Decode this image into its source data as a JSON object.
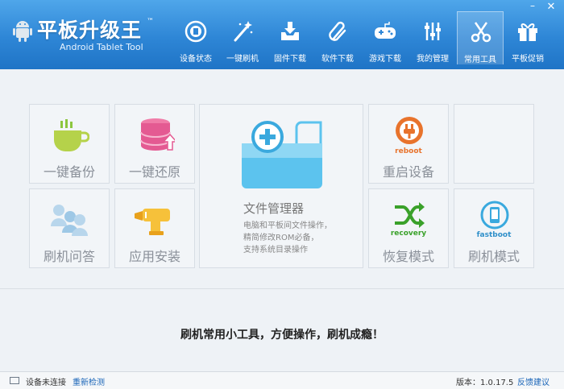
{
  "app": {
    "title": "平板升级王",
    "tm": "™",
    "subtitle": "Android Tablet Tool"
  },
  "window": {
    "minimize": "–",
    "close": "✕"
  },
  "nav": [
    {
      "label": "设备状态",
      "icon": "device-status-icon"
    },
    {
      "label": "一键刷机",
      "icon": "magic-wand-icon"
    },
    {
      "label": "固件下载",
      "icon": "firmware-download-icon"
    },
    {
      "label": "软件下载",
      "icon": "paperclip-icon"
    },
    {
      "label": "游戏下载",
      "icon": "gamepad-icon"
    },
    {
      "label": "我的管理",
      "icon": "sliders-icon"
    },
    {
      "label": "常用工具",
      "icon": "scissors-icon",
      "active": true
    },
    {
      "label": "平板促销",
      "icon": "gift-icon"
    }
  ],
  "tiles": {
    "backup": "一键备份",
    "restore": "一键还原",
    "file_manager": {
      "title": "文件管理器",
      "desc": [
        "电脑和平板间文件操作，",
        "精简修改ROM必备，",
        "支持系统目录操作"
      ]
    },
    "reboot": {
      "label": "重启设备",
      "icon_text": "reboot"
    },
    "qa": "刷机问答",
    "app_install": "应用安装",
    "recovery": {
      "label": "恢复模式",
      "icon_text": "recovery"
    },
    "fastboot": {
      "label": "刷机模式",
      "icon_text": "fastboot"
    }
  },
  "slogan": "刷机常用小工具，方便操作，刷机成瘾！",
  "status": {
    "connection": "设备未连接",
    "recheck": "重新检测",
    "version": "版本：1.0.17.5",
    "feedback": "反馈建议"
  },
  "colors": {
    "header": "#2e86d6",
    "accent_green": "#8cc63f",
    "accent_pink": "#e0457b",
    "accent_orange": "#e8732c",
    "link_blue": "#1a65b8"
  }
}
